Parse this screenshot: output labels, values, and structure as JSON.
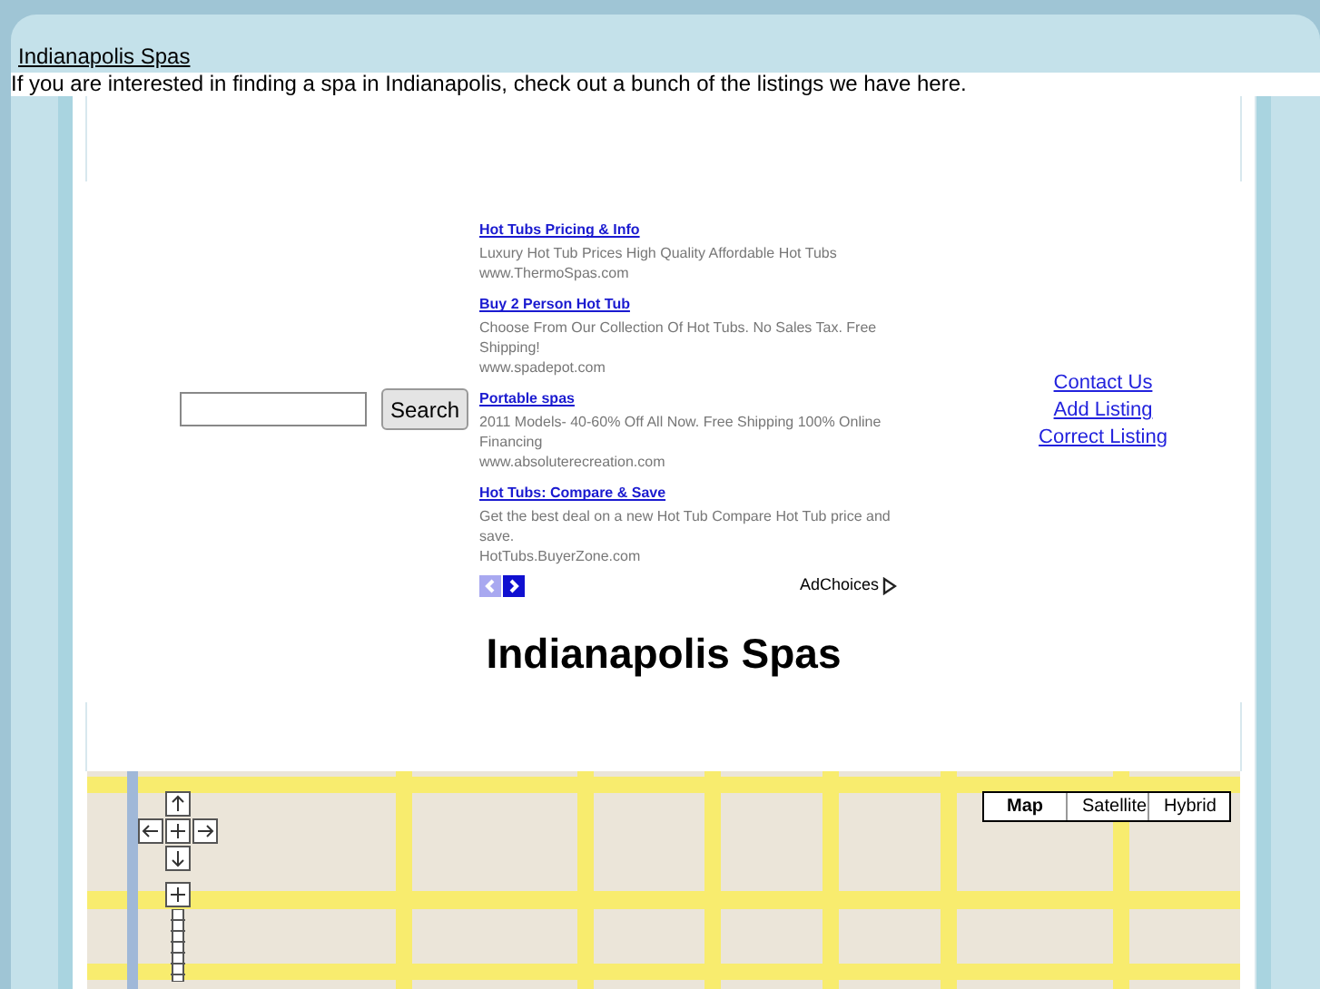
{
  "header": {
    "title_link": "Indianapolis Spas",
    "intro": "If you are interested in finding a spa in Indianapolis, check out a bunch of the listings we have here."
  },
  "search": {
    "button": "Search"
  },
  "ads": [
    {
      "title": "Hot Tubs Pricing & Info",
      "text": "Luxury Hot Tub Prices High Quality Affordable Hot Tubs",
      "url": "www.ThermoSpas.com"
    },
    {
      "title": "Buy 2 Person Hot Tub",
      "text": "Choose From Our Collection Of Hot Tubs. No Sales Tax. Free Shipping!",
      "url": "www.spadepot.com"
    },
    {
      "title": "Portable spas",
      "text": "2011 Models- 40-60% Off All Now. Free Shipping 100% Online Financing",
      "url": "www.absoluterecreation.com"
    },
    {
      "title": "Hot Tubs: Compare & Save",
      "text": "Get the best deal on a new Hot Tub Compare Hot Tub price and save.",
      "url": "HotTubs.BuyerZone.com"
    }
  ],
  "ad_choices": "AdChoices",
  "links": [
    "Contact Us",
    "Add Listing",
    "Correct Listing"
  ],
  "page_title": "Indianapolis Spas",
  "map": {
    "types": [
      {
        "label": "Map",
        "selected": true
      },
      {
        "label": "Satellite",
        "selected": false
      },
      {
        "label": "Hybrid",
        "selected": false
      }
    ]
  }
}
